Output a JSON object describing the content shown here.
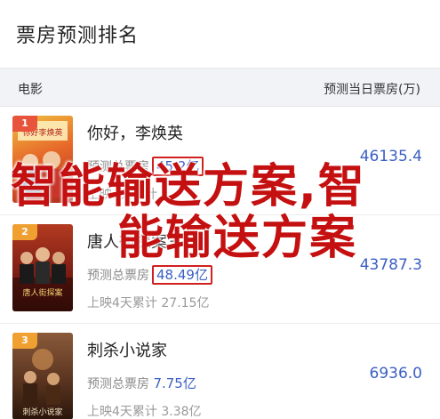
{
  "header": {
    "title": "票房预测排名"
  },
  "table_head": {
    "film": "电影",
    "pred": "预测当日票房(万)"
  },
  "rows": [
    {
      "rank": "1",
      "rank_color": "#e8533b",
      "name": "你好，李焕英",
      "pred_label": "预测总票房",
      "pred_value": "45.2亿",
      "release_label": "上映4天累计",
      "release_value": "",
      "today": "46135.4",
      "poster_text": "你好李焕英"
    },
    {
      "rank": "2",
      "rank_color": "#f0a030",
      "name": "唐人街探案3",
      "pred_label": "预测总票房",
      "pred_value": "48.49亿",
      "release_label": "上映4天累计",
      "release_value": "27.15亿",
      "today": "43787.3",
      "poster_text": "唐人街探案"
    },
    {
      "rank": "3",
      "rank_color": "#f0a030",
      "name": "刺杀小说家",
      "pred_label": "预测总票房",
      "pred_value": "7.75亿",
      "release_label": "上映4天累计",
      "release_value": "3.38亿",
      "today": "6936.0",
      "poster_text": "刺杀小说家"
    }
  ],
  "watermark": {
    "line1": "智能输送方案,智",
    "line2": "能输送方案"
  }
}
